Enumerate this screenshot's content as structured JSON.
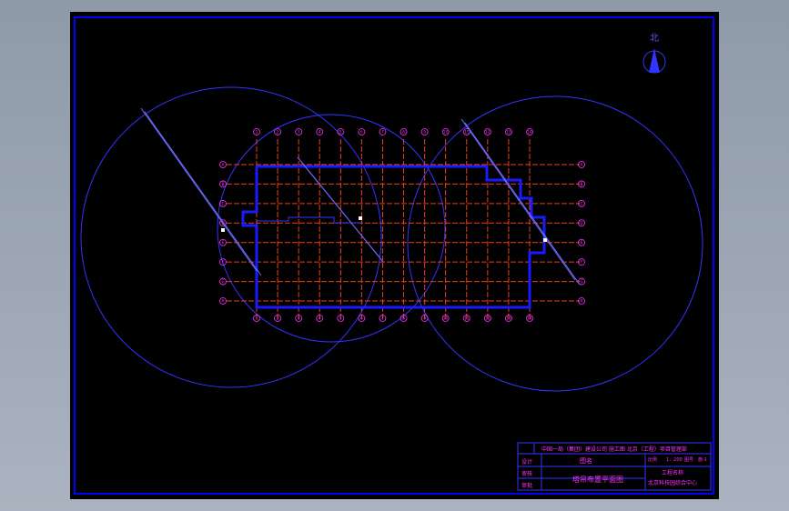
{
  "north_arrow": {
    "label": "北"
  },
  "grid": {
    "column_labels": [
      "1",
      "2",
      "3",
      "4",
      "5",
      "6",
      "7",
      "8",
      "9",
      "10",
      "11",
      "12",
      "13",
      "14"
    ],
    "row_labels": [
      "A",
      "B",
      "C",
      "D",
      "E",
      "F",
      "G",
      "H"
    ]
  },
  "colors": {
    "background": "#000000",
    "frame": "#0000ff",
    "circles": "#3333ff",
    "building_outline": "#1a1aff",
    "grid_lines": "#e8401c",
    "title_text": "#ff33ff"
  },
  "title_block": {
    "project": "中国一局（集团）建设公司 施工图 北京（工程）项目管理部",
    "drawing_type": "图名",
    "design": "设计",
    "review": "审核",
    "approve": "审批",
    "drawing_title": "塔吊布置平面图",
    "scale_label": "比例",
    "scale_value": "1：200",
    "sheet_label": "图号",
    "sheet_value": "施-1",
    "company_label": "工程名称",
    "company_value": "北京科技园综合中心"
  }
}
